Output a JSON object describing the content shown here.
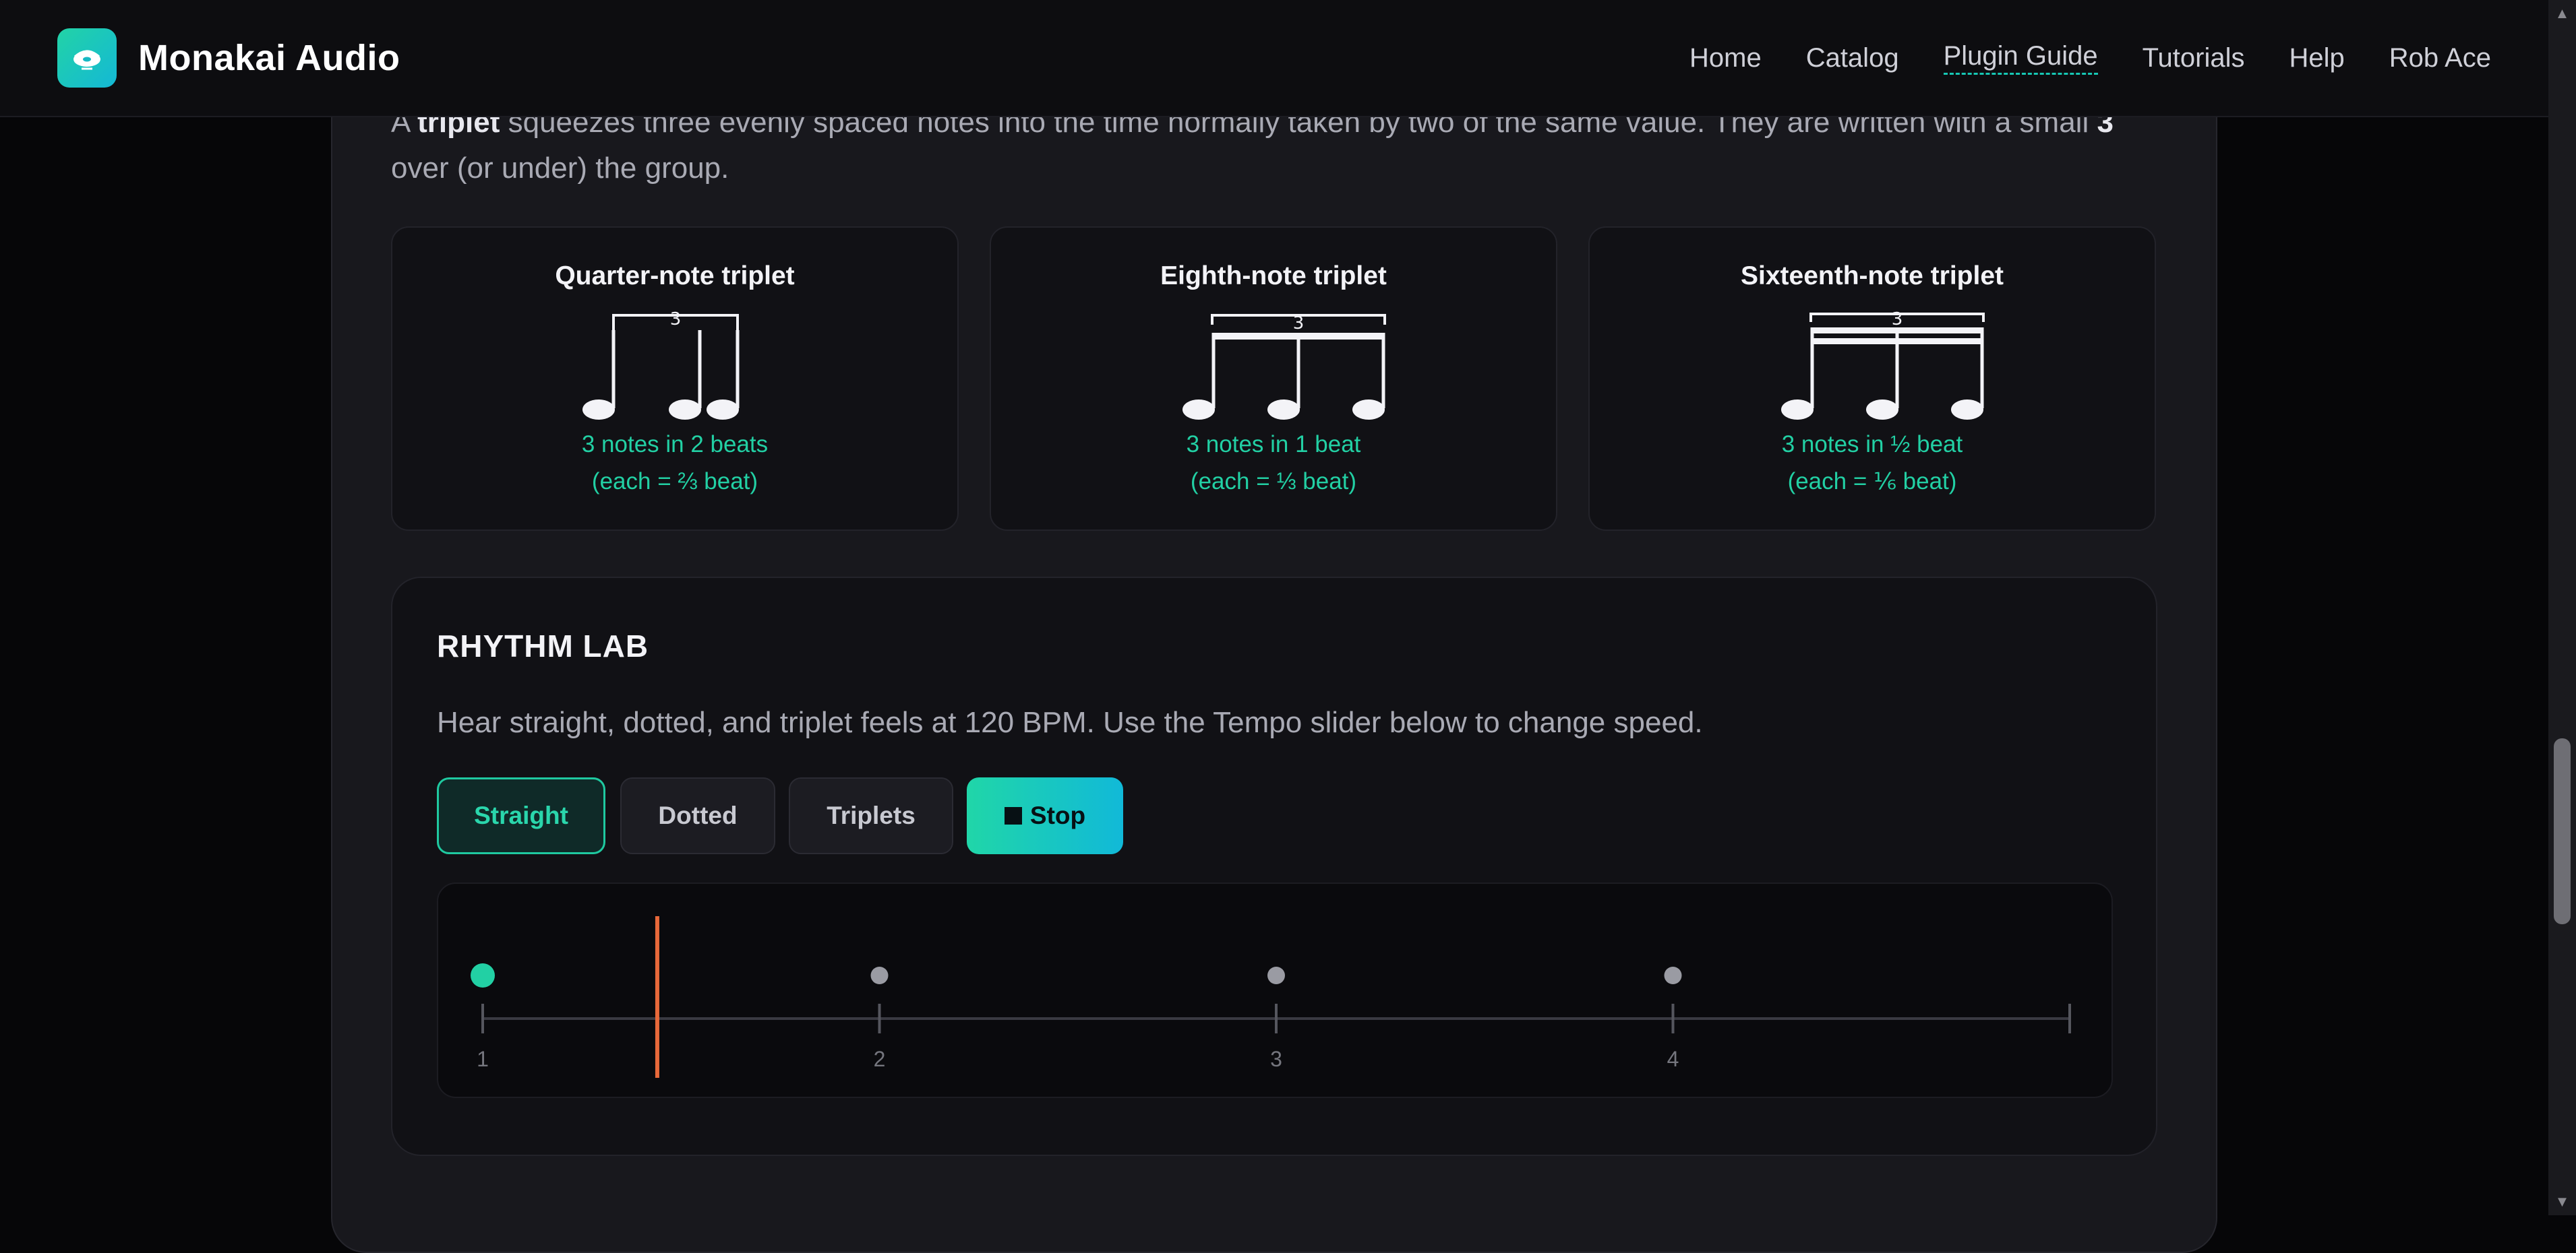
{
  "header": {
    "brand": "Monakai Audio",
    "nav": [
      "Home",
      "Catalog",
      "Plugin Guide",
      "Tutorials",
      "Help",
      "Rob Ace"
    ]
  },
  "intro": {
    "p1": "A ",
    "bold1": "triplet",
    "p2": " squeezes three evenly spaced notes into the time normally taken by two of the same value. They are written with a small ",
    "bold2": "3",
    "p3": " over (or under) the group."
  },
  "triplets": [
    {
      "title": "Quarter-note triplet",
      "line1": "3 notes in 2 beats",
      "line2": "(each = ⅔ beat)",
      "bracket_num": "3"
    },
    {
      "title": "Eighth-note triplet",
      "line1": "3 notes in 1 beat",
      "line2": "(each = ⅓ beat)",
      "bracket_num": "3"
    },
    {
      "title": "Sixteenth-note triplet",
      "line1": "3 notes in ½ beat",
      "line2": "(each = ⅙ beat)",
      "bracket_num": "3"
    }
  ],
  "lab": {
    "title": "RHYTHM LAB",
    "description": "Hear straight, dotted, and triplet feels at 120 BPM. Use the Tempo slider below to change speed.",
    "buttons": {
      "straight": "Straight",
      "dotted": "Dotted",
      "triplets": "Triplets",
      "stop": "Stop"
    },
    "active_mode": "Straight",
    "beats": [
      "1",
      "2",
      "3",
      "4"
    ],
    "active_beat_index": 0,
    "playhead_beats": 0.44
  },
  "colors": {
    "accent": "#22d0a4",
    "playhead": "#e8693a",
    "dot_inactive": "#9a9ba3"
  },
  "icons": {
    "logo": "disc-logo-icon",
    "stop": "stop-square-icon",
    "scroll_up": "chevron-up-icon",
    "scroll_down": "chevron-down-icon"
  }
}
